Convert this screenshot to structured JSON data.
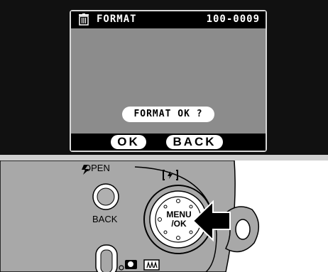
{
  "screen": {
    "title": "FORMAT",
    "frame_number": "100-0009",
    "prompt": "FORMAT OK ?",
    "softkeys": {
      "ok": "OK",
      "back": "BACK"
    }
  },
  "camera": {
    "open_label": "OPEN",
    "back_label": "BACK",
    "menu_ok_label_line1": "MENU",
    "menu_ok_label_line2": "/OK"
  },
  "colors": {
    "lcd": "#8c8c8c",
    "body": "#a8a8a8",
    "background": "#111111"
  }
}
